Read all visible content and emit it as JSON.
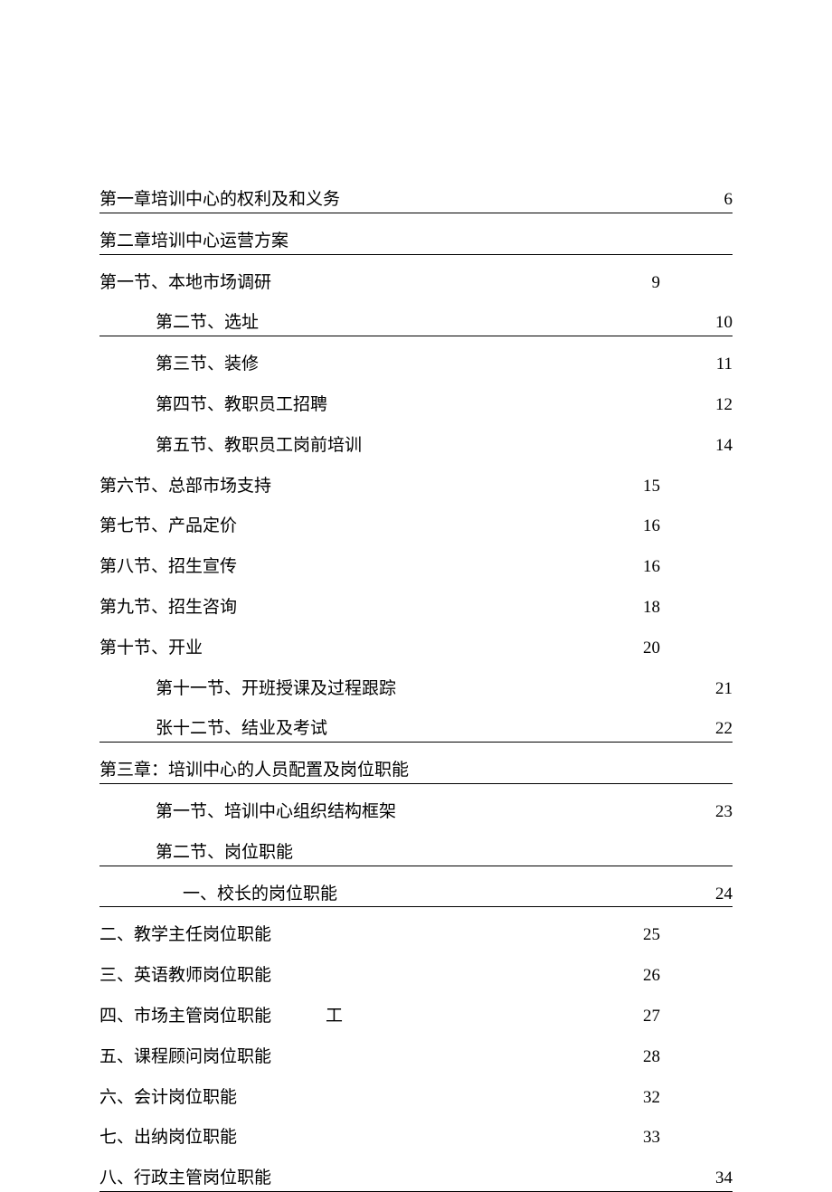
{
  "toc": [
    {
      "label": "第一章培训中心的权利及和义务",
      "page": "6",
      "indent": 0,
      "underlined": true,
      "width": "full"
    },
    {
      "label": "第二章培训中心运营方案",
      "page": "",
      "indent": 0,
      "underlined": true,
      "width": "full"
    },
    {
      "label": "第一节、本地市场调研",
      "page": "9",
      "indent": 0,
      "underlined": false,
      "width": "narrow"
    },
    {
      "label": "第二节、选址",
      "page": "10",
      "indent": 1,
      "underlined": true,
      "width": "full",
      "leadUnderline": true
    },
    {
      "label": "第三节、装修",
      "page": "11",
      "indent": 1,
      "underlined": false,
      "width": "full"
    },
    {
      "label": "第四节、教职员工招聘",
      "page": "12",
      "indent": 1,
      "underlined": false,
      "width": "full"
    },
    {
      "label": "第五节、教职员工岗前培训",
      "page": "14",
      "indent": 1,
      "underlined": false,
      "width": "full"
    },
    {
      "label": "第六节、总部市场支持",
      "page": "15",
      "indent": 0,
      "underlined": false,
      "width": "narrow"
    },
    {
      "label": "第七节、产品定价",
      "page": "16",
      "indent": 0,
      "underlined": false,
      "width": "narrow"
    },
    {
      "label": "第八节、招生宣传",
      "page": "16",
      "indent": 0,
      "underlined": false,
      "width": "narrow"
    },
    {
      "label": "第九节、招生咨询",
      "page": "18",
      "indent": 0,
      "underlined": false,
      "width": "narrow"
    },
    {
      "label": "第十节、开业",
      "page": "20",
      "indent": 0,
      "underlined": false,
      "width": "narrow"
    },
    {
      "label": "第十一节、开班授课及过程跟踪",
      "page": "21",
      "indent": 1,
      "underlined": false,
      "width": "full"
    },
    {
      "label": "张十二节、结业及考试",
      "page": "22",
      "indent": 1,
      "underlined": true,
      "width": "full",
      "leadUnderline": true
    },
    {
      "label": "第三章：培训中心的人员配置及岗位职能",
      "page": "",
      "indent": 0,
      "underlined": true,
      "width": "full"
    },
    {
      "label": "第一节、培训中心组织结构框架",
      "page": "23",
      "indent": 1,
      "underlined": false,
      "width": "full"
    },
    {
      "label": "第二节、岗位职能",
      "page": "",
      "indent": 1,
      "underlined": true,
      "width": "full",
      "leadUnderline": true
    },
    {
      "label": "一、校长的岗位职能",
      "page": "24",
      "indent": 2,
      "underlined": true,
      "width": "full",
      "leadUnderline": true
    },
    {
      "label": "二、教学主任岗位职能",
      "page": "25",
      "indent": 0,
      "underlined": false,
      "width": "narrow"
    },
    {
      "label": "三、英语教师岗位职能",
      "page": "26",
      "indent": 0,
      "underlined": false,
      "width": "narrow"
    },
    {
      "label": "四、市场主管岗位职能",
      "label2": "工",
      "page": "27",
      "indent": 0,
      "underlined": false,
      "width": "narrow",
      "twoPart": true
    },
    {
      "label": "五、课程顾问岗位职能",
      "page": "28",
      "indent": 0,
      "underlined": false,
      "width": "narrow"
    },
    {
      "label": "六、会计岗位职能",
      "page": "32",
      "indent": 0,
      "underlined": false,
      "width": "narrow"
    },
    {
      "label": "七、出纳岗位职能",
      "page": "33",
      "indent": 0,
      "underlined": false,
      "width": "narrow"
    },
    {
      "label": "八、行政主管岗位职能",
      "page": "34",
      "indent": 0,
      "underlined": true,
      "width": "full"
    }
  ]
}
